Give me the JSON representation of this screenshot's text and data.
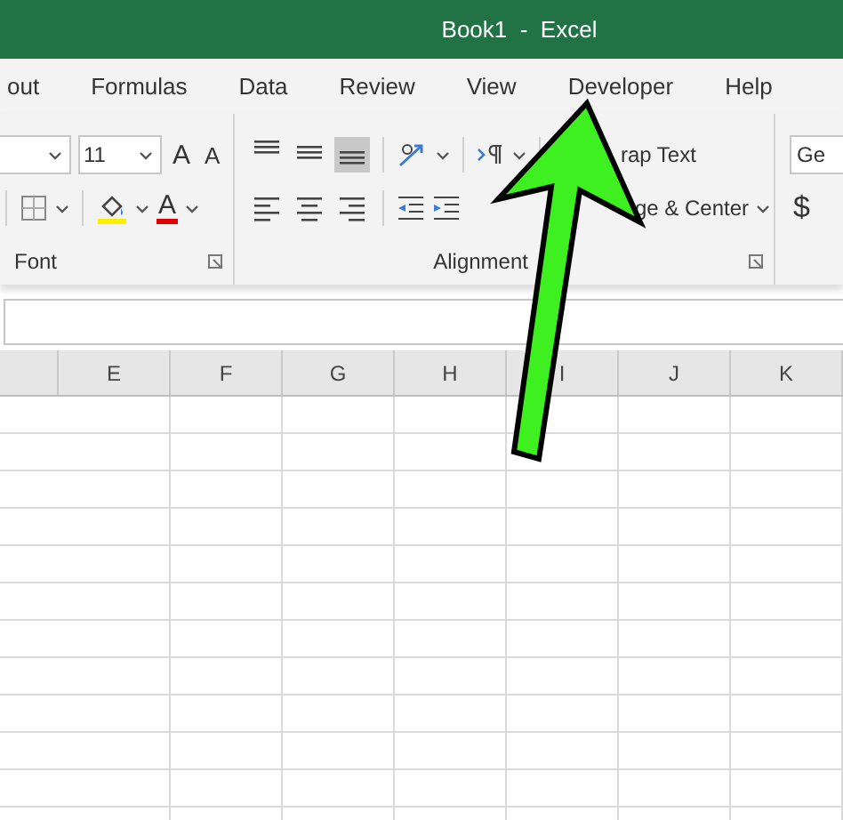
{
  "window": {
    "title": "Book1  -  Excel"
  },
  "tabs": [
    {
      "label": "out",
      "selected": false
    },
    {
      "label": "Formulas",
      "selected": false
    },
    {
      "label": "Data",
      "selected": false
    },
    {
      "label": "Review",
      "selected": false
    },
    {
      "label": "View",
      "selected": false
    },
    {
      "label": "Developer",
      "selected": false
    },
    {
      "label": "Help",
      "selected": false
    }
  ],
  "font_group": {
    "size": "11",
    "grow_glyph": "A",
    "shrink_glyph": "A",
    "color_glyph": "A",
    "label": "Font"
  },
  "alignment_group": {
    "vertical": [
      {
        "kind": "top",
        "selected": false
      },
      {
        "kind": "middle",
        "selected": false
      },
      {
        "kind": "bottom",
        "selected": true
      }
    ],
    "horizontal": [
      {
        "kind": "left",
        "selected": false
      },
      {
        "kind": "center",
        "selected": false
      },
      {
        "kind": "right",
        "selected": false
      }
    ],
    "wrap_text": "rap Text",
    "merge": "ge & Center",
    "label": "Alignment"
  },
  "number_group": {
    "format": "Ge",
    "currency": "$"
  },
  "columns": [
    "E",
    "F",
    "G",
    "H",
    "I",
    "J",
    "K"
  ],
  "annotation": {
    "kind": "arrow"
  }
}
